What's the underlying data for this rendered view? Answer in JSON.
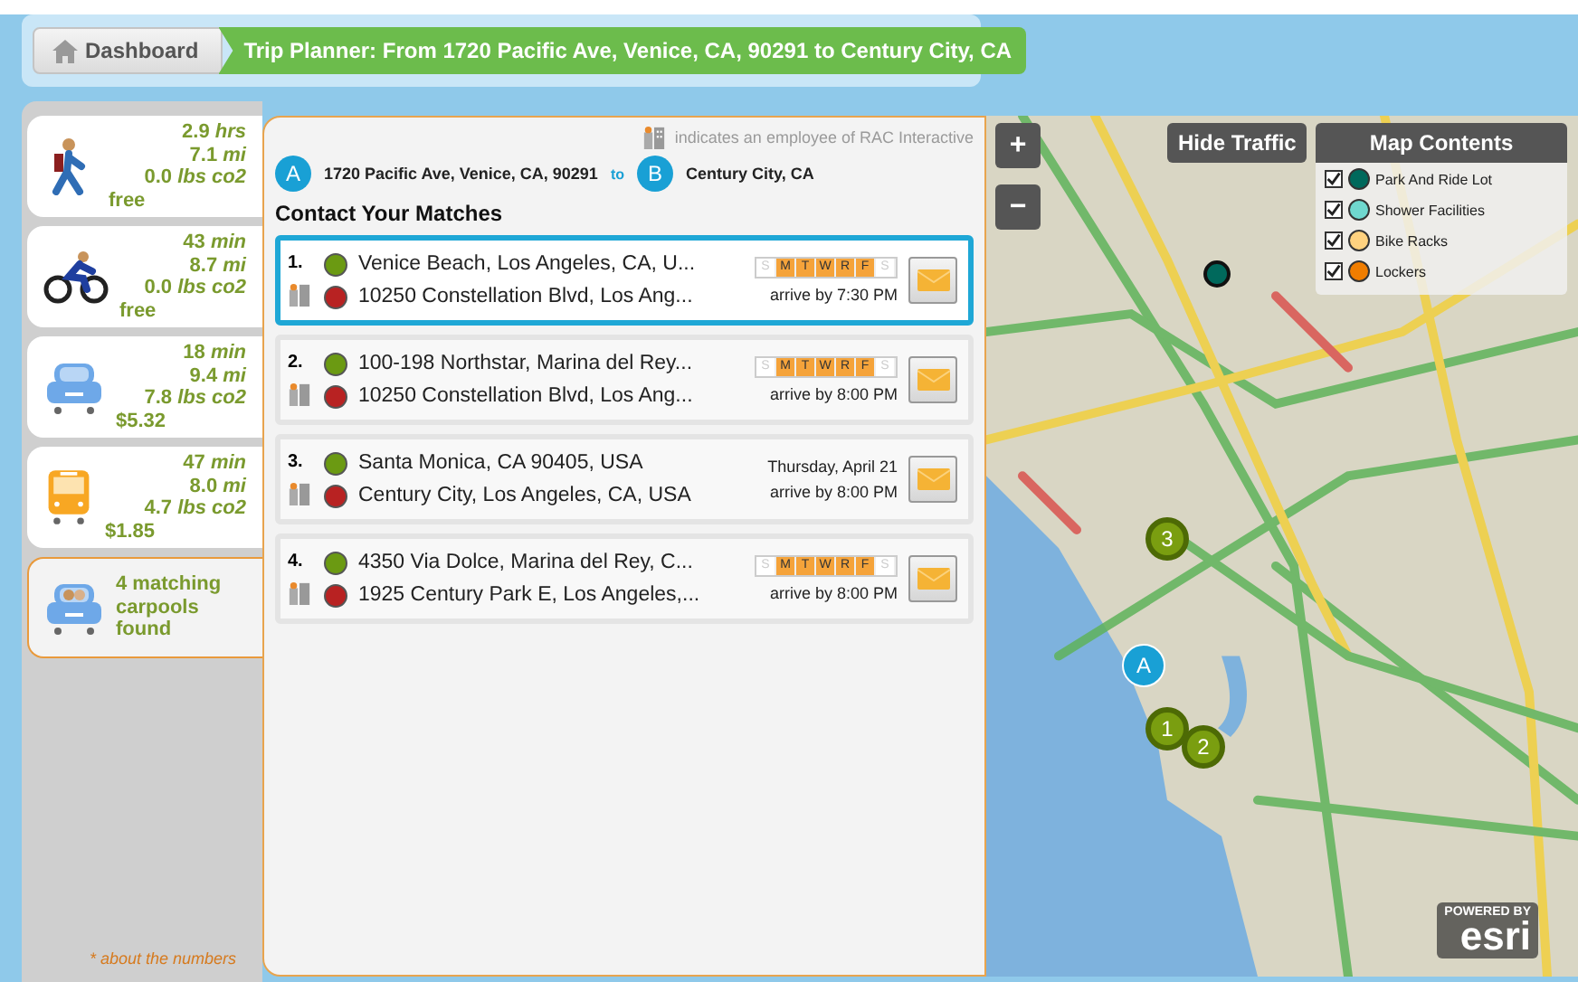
{
  "breadcrumb": {
    "home": "Dashboard",
    "current": "Trip Planner: From 1720 Pacific Ave, Venice, CA, 90291 to Century City, CA"
  },
  "modes": [
    {
      "kind": "walk",
      "selected": false,
      "lines": [
        "2.9 *hrs*",
        "7.1 *mi*",
        "0.0 *lbs co2*"
      ],
      "cost": "free"
    },
    {
      "kind": "bike",
      "selected": false,
      "lines": [
        "43 *min*",
        "8.7 *mi*",
        "0.0 *lbs co2*"
      ],
      "cost": "free"
    },
    {
      "kind": "car",
      "selected": false,
      "lines": [
        "18 *min*",
        "9.4 *mi*",
        "7.8 *lbs co2*"
      ],
      "cost": "$5.32"
    },
    {
      "kind": "bus",
      "selected": false,
      "lines": [
        "47 *min*",
        "8.0 *mi*",
        "4.7 *lbs co2*"
      ],
      "cost": "$1.85"
    },
    {
      "kind": "carpool",
      "selected": true,
      "lines": [
        "4 matching carpools found"
      ]
    }
  ],
  "about_link": "* about the numbers",
  "matches_panel": {
    "legend": "indicates an employee of RAC Interactive",
    "from_marker": "A",
    "from": "1720 Pacific Ave, Venice, CA, 90291",
    "to_word": "to",
    "to_marker": "B",
    "to": "Century City, CA",
    "heading": "Contact Your Matches",
    "matches": [
      {
        "number": "1.",
        "selected": true,
        "origin": "Venice Beach, Los Angeles, CA, U...",
        "destination": "10250 Constellation Blvd, Los Ang...",
        "kind": "days",
        "days": [
          {
            "label": "S",
            "on": false
          },
          {
            "label": "M",
            "on": true
          },
          {
            "label": "T",
            "on": true
          },
          {
            "label": "W",
            "on": true
          },
          {
            "label": "R",
            "on": true
          },
          {
            "label": "F",
            "on": true
          },
          {
            "label": "S",
            "on": false
          }
        ],
        "arrive": "arrive by 7:30 PM"
      },
      {
        "number": "2.",
        "selected": false,
        "origin": "100-198 Northstar, Marina del Rey...",
        "destination": "10250 Constellation Blvd, Los Ang...",
        "kind": "days",
        "days": [
          {
            "label": "S",
            "on": false
          },
          {
            "label": "M",
            "on": true
          },
          {
            "label": "T",
            "on": true
          },
          {
            "label": "W",
            "on": true
          },
          {
            "label": "R",
            "on": true
          },
          {
            "label": "F",
            "on": true
          },
          {
            "label": "S",
            "on": false
          }
        ],
        "arrive": "arrive by 8:00 PM"
      },
      {
        "number": "3.",
        "selected": false,
        "origin": "Santa Monica, CA 90405, USA",
        "destination": "Century City, Los Angeles, CA, USA",
        "kind": "date",
        "date": "Thursday, April 21",
        "arrive": "arrive by 8:00 PM"
      },
      {
        "number": "4.",
        "selected": false,
        "origin": "4350 Via Dolce, Marina del Rey, C...",
        "destination": "1925 Century Park E, Los Angeles,...",
        "kind": "days",
        "days": [
          {
            "label": "S",
            "on": false
          },
          {
            "label": "M",
            "on": true
          },
          {
            "label": "T",
            "on": true
          },
          {
            "label": "W",
            "on": true
          },
          {
            "label": "R",
            "on": true
          },
          {
            "label": "F",
            "on": true
          },
          {
            "label": "S",
            "on": false
          }
        ],
        "arrive": "arrive by 8:00 PM"
      }
    ]
  },
  "map": {
    "zoom_in": "+",
    "zoom_out": "−",
    "traffic_button": "Hide Traffic",
    "contents_title": "Map Contents",
    "layers": [
      {
        "label": "Park And Ride Lot",
        "checked": true,
        "color": "#00695c"
      },
      {
        "label": "Shower Facilities",
        "checked": true,
        "color": "#6fd8cf"
      },
      {
        "label": "Bike Racks",
        "checked": true,
        "color": "#ffd27f"
      },
      {
        "label": "Lockers",
        "checked": true,
        "color": "#f07d00"
      }
    ],
    "markers": [
      {
        "kind": "start",
        "label": "A"
      },
      {
        "kind": "match",
        "label": "1"
      },
      {
        "kind": "match",
        "label": "2"
      },
      {
        "kind": "match",
        "label": "3"
      }
    ],
    "attribution": {
      "top": "POWERED BY",
      "brand": "esri"
    }
  }
}
